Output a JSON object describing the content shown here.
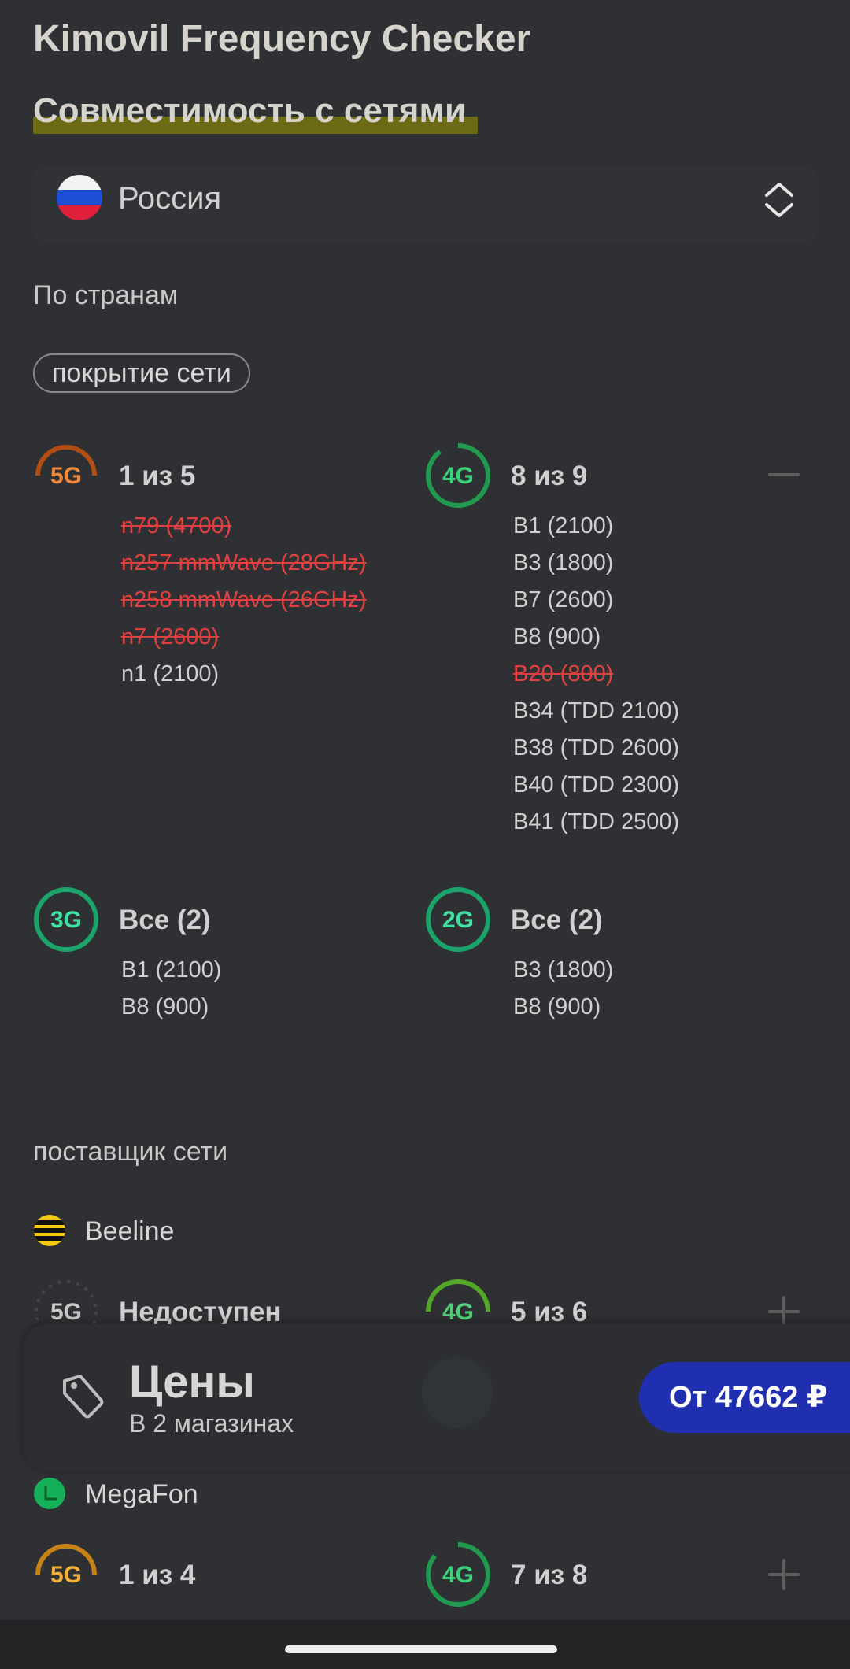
{
  "app_title": "Kimovil Frequency Checker",
  "section_title": "Совместимость с сетями",
  "country": {
    "name": "Россия",
    "flag_icon": "russia-flag-icon"
  },
  "by_country_label": "По странам",
  "chip_label": "покрытие сети",
  "networks": {
    "g5": {
      "label": "5G",
      "count": "1 из 5",
      "color": "#e0772f",
      "bands": [
        {
          "text": "n79 (4700)",
          "supported": false
        },
        {
          "text": "n257 mmWave (28GHz)",
          "supported": false
        },
        {
          "text": "n258 mmWave (26GHz)",
          "supported": false
        },
        {
          "text": "n7 (2600)",
          "supported": false
        },
        {
          "text": "n1 (2100)",
          "supported": true
        }
      ]
    },
    "g4": {
      "label": "4G",
      "count": "8 из 9",
      "color": "#35c167",
      "bands": [
        {
          "text": "B1 (2100)",
          "supported": true
        },
        {
          "text": "B3 (1800)",
          "supported": true
        },
        {
          "text": "B7 (2600)",
          "supported": true
        },
        {
          "text": "B8 (900)",
          "supported": true
        },
        {
          "text": "B20 (800)",
          "supported": false
        },
        {
          "text": "B34 (TDD 2100)",
          "supported": true
        },
        {
          "text": "B38 (TDD 2600)",
          "supported": true
        },
        {
          "text": "B40 (TDD 2300)",
          "supported": true
        },
        {
          "text": "B41 (TDD 2500)",
          "supported": true
        }
      ]
    },
    "g3": {
      "label": "3G",
      "count": "Все (2)",
      "color": "#25c08a",
      "bands": [
        {
          "text": "B1 (2100)",
          "supported": true
        },
        {
          "text": "B8 (900)",
          "supported": true
        }
      ]
    },
    "g2": {
      "label": "2G",
      "count": "Все (2)",
      "color": "#25c08a",
      "bands": [
        {
          "text": "B3 (1800)",
          "supported": true
        },
        {
          "text": "B8 (900)",
          "supported": true
        }
      ]
    }
  },
  "provider_label": "поставщик сети",
  "operators": [
    {
      "name": "Beeline",
      "g5_label": "5G",
      "g5_status": "Недоступен",
      "g4_label": "4G",
      "g4_count": "5 из 6"
    },
    {
      "name": "MegaFon",
      "g5_label": "5G",
      "g5_count": "1 из 4",
      "g4_label": "4G",
      "g4_count": "7 из 8"
    }
  ],
  "prices": {
    "title": "Цены",
    "subtitle": "В 2 магазинах",
    "button": "От 47662 ₽"
  },
  "colors": {
    "background": "#2f3033",
    "accent_button": "#1f2fb0",
    "unsupported": "#e0413f",
    "ring_5g": "#e0772f",
    "ring_4g": "#35c167"
  }
}
